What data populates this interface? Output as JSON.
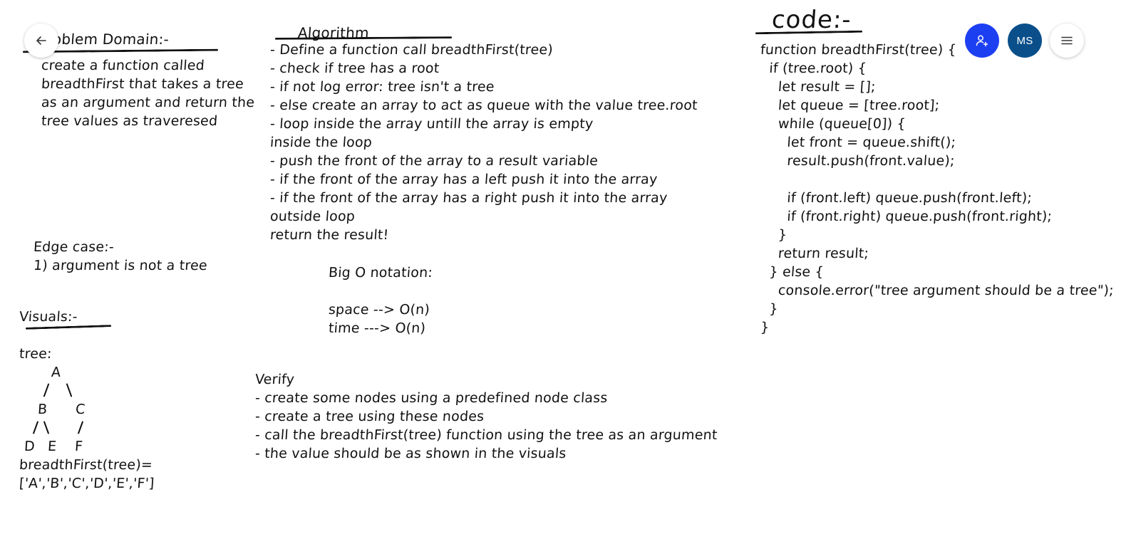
{
  "toolbar": {
    "back_icon": "arrow-left-icon",
    "share_icon": "add-person-icon",
    "avatar_initials": "MS",
    "menu_icon": "hamburger-menu-icon",
    "share_color": "#1d3ff2",
    "avatar_color": "#0a4f8a"
  },
  "problem_domain": {
    "heading": "oblem Domain:-",
    "lines": [
      "create a function called",
      "breadthFirst that takes a tree",
      "as an argument and return the",
      "tree values as traveresed"
    ]
  },
  "edge_case": {
    "heading": "Edge case:-",
    "lines": [
      "1) argument is not a tree"
    ]
  },
  "visuals": {
    "heading": "Visuals:-",
    "tree_label": "tree:",
    "nodes": [
      "A",
      "B",
      "C",
      "D",
      "E",
      "F"
    ],
    "result_lines": [
      "breadthFirst(tree)=",
      "['A','B','C','D','E','F']"
    ]
  },
  "algorithm": {
    "heading": "Algorithm",
    "lines": [
      "- Define a function call breadthFirst(tree)",
      "- check if tree has a root",
      "- if not log error: tree isn't a tree",
      "- else create an array to act as queue with the value tree.root",
      "- loop inside the array untill the array is empty",
      "inside the loop",
      "- push the front of the array to a result variable",
      "- if the front of the array has a left push it into the array",
      "- if the front of the array has a right push it into the array",
      "outside loop",
      "return the result!"
    ]
  },
  "big_o": {
    "heading": "Big O notation:",
    "lines": [
      "space --> O(n)",
      "time ---> O(n)"
    ]
  },
  "verify": {
    "heading": "Verify",
    "lines": [
      "- create some nodes using a predefined node class",
      "- create a tree using these nodes",
      "- call the breadthFirst(tree) function using the tree as an argument",
      "- the value should be as shown in the visuals"
    ]
  },
  "code": {
    "heading": "code:-",
    "lines": [
      "function breadthFirst(tree) {",
      "  if (tree.root) {",
      "    let result = [];",
      "    let queue = [tree.root];",
      "    while (queue[0]) {",
      "      let front = queue.shift();",
      "      result.push(front.value);",
      "",
      "      if (front.left) queue.push(front.left);",
      "      if (front.right) queue.push(front.right);",
      "    }",
      "    return result;",
      "  } else {",
      "    console.error(\"tree argument should be a tree\");",
      "  }",
      "}"
    ]
  }
}
